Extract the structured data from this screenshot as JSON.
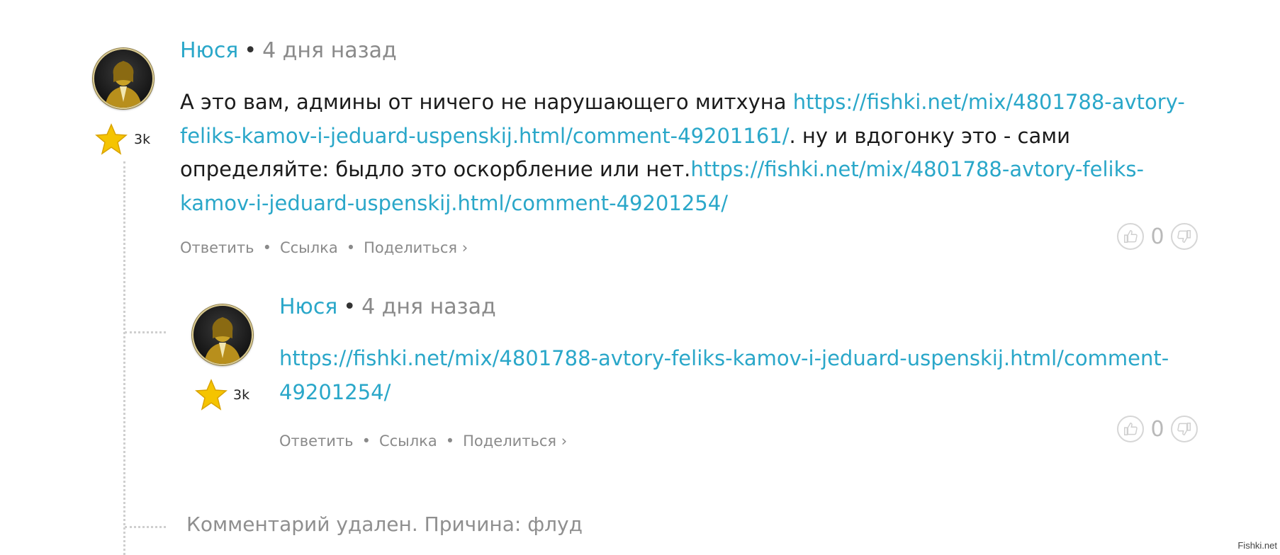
{
  "comments": [
    {
      "author": "Нюся",
      "separator": "•",
      "time": "4 дня назад",
      "rating": "3k",
      "text_1": "А это вам, админы от ничего не нарушающего митхуна ",
      "link_1": "https://fishki.net/mix/4801788-avtory-feliks-kamov-i-jeduard-uspenskij.html/comment-49201161/",
      "text_2": ". ну и вдогонку это - сами определяйте: быдло это оскорбление или нет.",
      "link_2": "https://fishki.net/mix/4801788-avtory-feliks-kamov-i-jeduard-uspenskij.html/comment-49201254/",
      "actions": {
        "reply": "Ответить",
        "link": "Ссылка",
        "share": "Поделиться ›"
      },
      "votes": "0"
    },
    {
      "author": "Нюся",
      "separator": "•",
      "time": "4 дня назад",
      "rating": "3k",
      "link_1": "https://fishki.net/mix/4801788-avtory-feliks-kamov-i-jeduard-uspenskij.html/comment-49201254/",
      "actions": {
        "reply": "Ответить",
        "link": "Ссылка",
        "share": "Поделиться ›"
      },
      "votes": "0"
    }
  ],
  "action_separator": "•",
  "deleted_notice": "Комментарий удален. Причина: флуд",
  "watermark": "Fishki.net",
  "icons": {
    "avatar": "user-avatar-icon",
    "star": "star-rank-icon",
    "like": "thumb-up-icon",
    "dislike": "thumb-down-icon"
  },
  "colors": {
    "link": "#2aa7c9",
    "muted": "#8a8a8a",
    "star": "#f5c400"
  }
}
